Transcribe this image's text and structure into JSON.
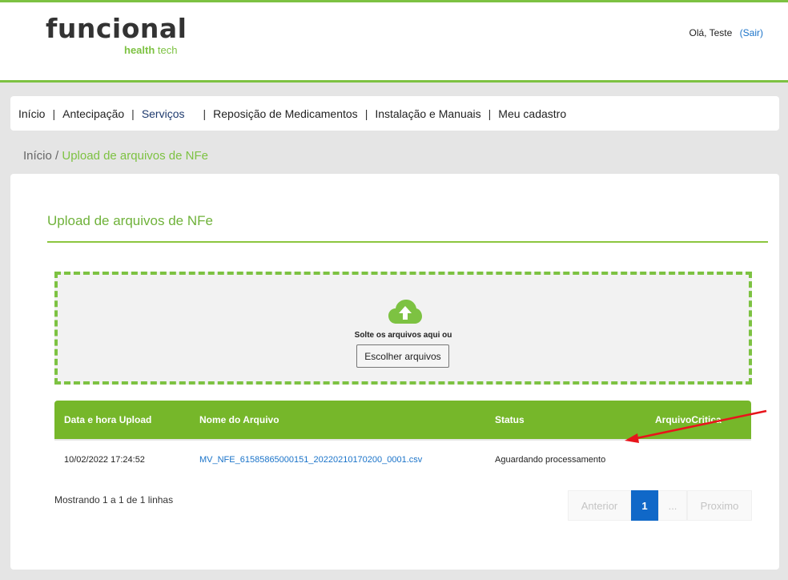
{
  "header": {
    "logo_main": "funcional",
    "logo_sub_bold": "health",
    "logo_sub_rest": " tech",
    "greeting": "Olá, Teste",
    "logout": "(Sair)"
  },
  "nav": {
    "items": [
      "Início",
      "Antecipação",
      "Serviços",
      "Reposição de Medicamentos",
      "Instalação e Manuais",
      "Meu cadastro"
    ],
    "separator": "|"
  },
  "breadcrumb": {
    "home": "Início",
    "separator": " / ",
    "current": "Upload de arquivos de NFe"
  },
  "card": {
    "title": "Upload de arquivos de NFe"
  },
  "dropzone": {
    "icon": "cloud-upload-icon",
    "text": "Solte os arquivos aqui ou",
    "button": "Escolher arquivos"
  },
  "table": {
    "columns": [
      "Data e hora Upload",
      "Nome do Arquivo",
      "Status",
      "ArquivoCritica"
    ],
    "rows": [
      {
        "date": "10/02/2022 17:24:52",
        "file": "MV_NFE_61585865000151_20220210170200_0001.csv",
        "status": "Aguardando processamento",
        "critica": ""
      }
    ]
  },
  "footer": {
    "showing": "Mostrando 1 a 1 de 1 linhas",
    "pagination": {
      "prev": "Anterior",
      "current": "1",
      "dots": "...",
      "next": "Proximo"
    }
  },
  "colors": {
    "brand_green": "#7dc242",
    "table_header": "#76b72a",
    "link_blue": "#1a73c9",
    "annotation_arrow": "#e8141b"
  }
}
